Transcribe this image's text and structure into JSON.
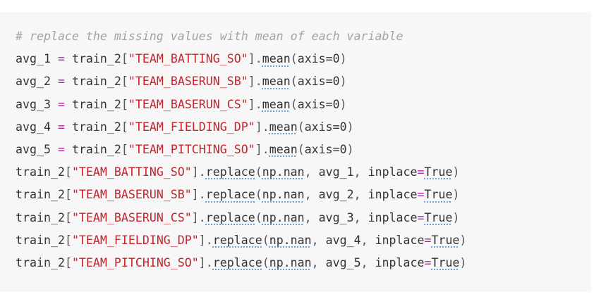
{
  "comment": "# replace the missing values with mean of each variable",
  "assignments": [
    {
      "var": "avg_1",
      "df": "train_2",
      "column": "\"TEAM_BATTING_SO\"",
      "method": "mean",
      "args": "axis=0"
    },
    {
      "var": "avg_2",
      "df": "train_2",
      "column": "\"TEAM_BASERUN_SB\"",
      "method": "mean",
      "args": "axis=0"
    },
    {
      "var": "avg_3",
      "df": "train_2",
      "column": "\"TEAM_BASERUN_CS\"",
      "method": "mean",
      "args": "axis=0"
    },
    {
      "var": "avg_4",
      "df": "train_2",
      "column": "\"TEAM_FIELDING_DP\"",
      "method": "mean",
      "args": "axis=0"
    },
    {
      "var": "avg_5",
      "df": "train_2",
      "column": "\"TEAM_PITCHING_SO\"",
      "method": "mean",
      "args": "axis=0"
    }
  ],
  "replacements": [
    {
      "df": "train_2",
      "column": "\"TEAM_BATTING_SO\"",
      "method": "replace",
      "arg1": "np.nan",
      "arg2": "avg_1",
      "kw": "inplace",
      "val": "True"
    },
    {
      "df": "train_2",
      "column": "\"TEAM_BASERUN_SB\"",
      "method": "replace",
      "arg1": "np.nan",
      "arg2": "avg_2",
      "kw": "inplace",
      "val": "True"
    },
    {
      "df": "train_2",
      "column": "\"TEAM_BASERUN_CS\"",
      "method": "replace",
      "arg1": "np.nan",
      "arg2": "avg_3",
      "kw": "inplace",
      "val": "True"
    },
    {
      "df": "train_2",
      "column": "\"TEAM_FIELDING_DP\"",
      "method": "replace",
      "arg1": "np.nan",
      "arg2": "avg_4",
      "kw": "inplace",
      "val": "True"
    },
    {
      "df": "train_2",
      "column": "\"TEAM_PITCHING_SO\"",
      "method": "replace",
      "arg1": "np.nan",
      "arg2": "avg_5",
      "kw": "inplace",
      "val": "True"
    }
  ],
  "colors": {
    "background": "#f7f7f7",
    "comment": "#a3a3a3",
    "string": "#c8232c",
    "operator": "#a626a4",
    "text": "#333333"
  }
}
